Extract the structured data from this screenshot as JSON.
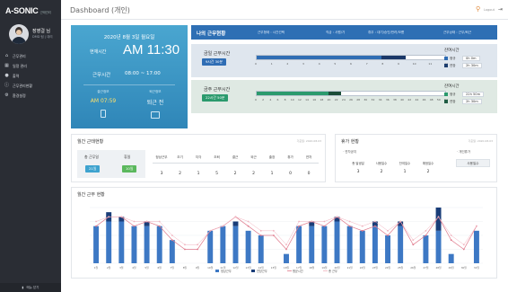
{
  "app": {
    "logo": "A-SONIC",
    "logo_sub": "근태관리",
    "user_name": "장영걸 님",
    "user_dept": "DMD 팀 | 대리",
    "menu": [
      {
        "icon": "home-icon",
        "glyph": "⌂",
        "label": "근무관리"
      },
      {
        "icon": "calendar-icon",
        "glyph": "▦",
        "label": "일정 관리"
      },
      {
        "icon": "user-icon",
        "glyph": "●",
        "label": "출력"
      },
      {
        "icon": "info-icon",
        "glyph": "ⓘ",
        "label": "근무관리현황"
      },
      {
        "icon": "settings-icon",
        "glyph": "⚙",
        "label": "환경설정"
      }
    ],
    "footer": "메뉴 닫기",
    "page_title": "Dashboard (개인)",
    "logout": "Logout"
  },
  "worktime": {
    "date": "2020년 8월 3일 월요일",
    "now_label": "현재시간",
    "now": "AM 11:30",
    "hours_label": "근무시간",
    "hours": "08:00 ~ 17:00",
    "in_label": "출근정보",
    "in_value": "AM 07:59",
    "out_label": "퇴근정보",
    "out_value": "퇴근 전"
  },
  "status": {
    "title": "나의 근무현황",
    "items": [
      "근무형태 : 시간선택",
      "직급 : 사원/가",
      "휴무 : 대기/승인/반려/모름",
      "근무상태 : 근무/퇴근"
    ],
    "weekly": {
      "label": "금일 근무시간",
      "badge": "9시간 30분",
      "side_title": "잔여시간",
      "rows": [
        {
          "key": "정규",
          "value": "0h 0m",
          "color": "#2f6db4"
        },
        {
          "key": "연장",
          "value": "2h 30m",
          "color": "#1c3d6e"
        }
      ],
      "ticks": [
        "0",
        "1",
        "2",
        "3",
        "4",
        "5",
        "6",
        "7",
        "8",
        "9",
        "10",
        "11",
        "12"
      ],
      "fill_pct": 0.79,
      "fill2_start": 0.66,
      "fill_color": "#2f6db4",
      "fill2_color": "#1a3868"
    },
    "monthly": {
      "label": "금주 근무시간",
      "badge": "22시간 50분",
      "side_title": "잔여시간",
      "rows": [
        {
          "key": "정규",
          "value": "22h 50m",
          "color": "#2b9a6d"
        },
        {
          "key": "연장",
          "value": "2h 30m",
          "color": "#1f5c43"
        }
      ],
      "ticks": [
        "0",
        "2",
        "4",
        "6",
        "8",
        "10",
        "12",
        "14",
        "16",
        "18",
        "20",
        "22",
        "24",
        "26",
        "28",
        "30",
        "32",
        "34",
        "36",
        "38",
        "40",
        "42",
        "44",
        "46",
        "48",
        "50",
        "52"
      ],
      "fill_pct": 0.45,
      "fill2_start": 0.38,
      "fill_color": "#2b9a6d",
      "fill2_color": "#1b4d38"
    }
  },
  "attendance": {
    "title": "월간 근태현황",
    "note": "기준일: 2020.08.03",
    "box": {
      "h1": "총 근무일",
      "h2": "휴일",
      "v1": "21일",
      "v2": "10일",
      "c1": "#3ea3cf",
      "c2": "#5bb85d"
    },
    "headers": [
      "정상근무",
      "조기",
      "지각",
      "조퇴",
      "결근",
      "외근",
      "출장",
      "휴가",
      "연차"
    ],
    "values": [
      "3",
      "2",
      "1",
      "5",
      "2",
      "2",
      "1",
      "0",
      "0"
    ]
  },
  "vacation": {
    "title": "휴가 현황",
    "note": "기준일: 2020.08.03",
    "sub1": "· 연차공지",
    "sub2": "· 개인휴가",
    "headers": [
      "총 발생일",
      "사용일수",
      "잔여일수",
      "예정일수"
    ],
    "values": [
      "3",
      "2",
      "1",
      "2"
    ],
    "btn": "사용일수"
  },
  "chart_data": {
    "type": "bar",
    "title": "월간 근무 현황",
    "legend": [
      "정상근무",
      "연장근무",
      "평균시간",
      "총 근무"
    ],
    "categories": [
      "1일",
      "2일",
      "3일",
      "4일",
      "5일",
      "6일",
      "7일",
      "8일",
      "9일",
      "10일",
      "11일",
      "12일",
      "13일",
      "14일",
      "15일",
      "16일",
      "17일",
      "18일",
      "19일",
      "20일",
      "21일",
      "22일",
      "23일",
      "24일",
      "25일",
      "26일",
      "27일",
      "28일",
      "29일",
      "30일",
      "31일"
    ],
    "ylim": [
      0,
      12
    ],
    "series": [
      {
        "name": "정상근무",
        "color": "#3d78c4",
        "values": [
          8,
          9,
          9,
          8,
          8,
          8,
          5,
          0,
          0,
          7,
          8,
          8,
          7,
          6,
          0,
          2,
          8,
          8,
          8,
          9,
          8,
          7,
          8,
          6,
          8,
          0,
          6,
          7,
          2,
          0,
          7
        ]
      },
      {
        "name": "연장근무",
        "color": "#1a3d78",
        "values": [
          0,
          2,
          1,
          0,
          1,
          0,
          0,
          0,
          0,
          0,
          0,
          1,
          0,
          0,
          0,
          0,
          0,
          1,
          0,
          1,
          0,
          0,
          1,
          0,
          1,
          0,
          0,
          5,
          0,
          0,
          0
        ]
      }
    ],
    "lines": [
      {
        "name": "평균시간",
        "color": "#e07a8c",
        "values": [
          8,
          10,
          10,
          8,
          9,
          8,
          5,
          3,
          3,
          7,
          8,
          10,
          8,
          6,
          6,
          3,
          8,
          9,
          8,
          10,
          8,
          7,
          8,
          6,
          9,
          4,
          6,
          10,
          5,
          3,
          8
        ]
      },
      {
        "name": "총 근무",
        "color": "#f1b3bf",
        "values": [
          9,
          10,
          10,
          9,
          9,
          9,
          6,
          4,
          4,
          7,
          8,
          10,
          9,
          7,
          7,
          4,
          9,
          9,
          9,
          10,
          9,
          8,
          9,
          7,
          9,
          5,
          7,
          10,
          6,
          4,
          8
        ]
      }
    ]
  },
  "colors": {
    "sidebar": "#2a2d34",
    "primary": "#2e6fb4",
    "accent": "#4aa6d0"
  }
}
